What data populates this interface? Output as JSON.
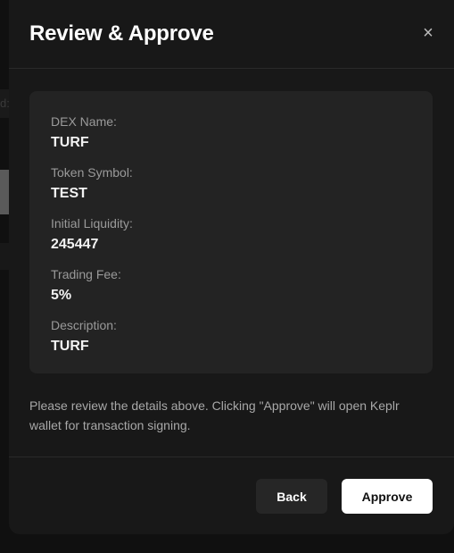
{
  "modal": {
    "title": "Review & Approve",
    "close_symbol": "×"
  },
  "details": [
    {
      "label": "DEX Name:",
      "value": "TURF"
    },
    {
      "label": "Token Symbol:",
      "value": "TEST"
    },
    {
      "label": "Initial Liquidity:",
      "value": "245447"
    },
    {
      "label": "Trading Fee:",
      "value": "5%"
    },
    {
      "label": "Description:",
      "value": "TURF"
    }
  ],
  "notice": "Please review the details above. Clicking \"Approve\" will open Keplr wallet for transaction signing.",
  "footer": {
    "back_label": "Back",
    "approve_label": "Approve"
  },
  "background": {
    "partial_glyph": "d:"
  }
}
